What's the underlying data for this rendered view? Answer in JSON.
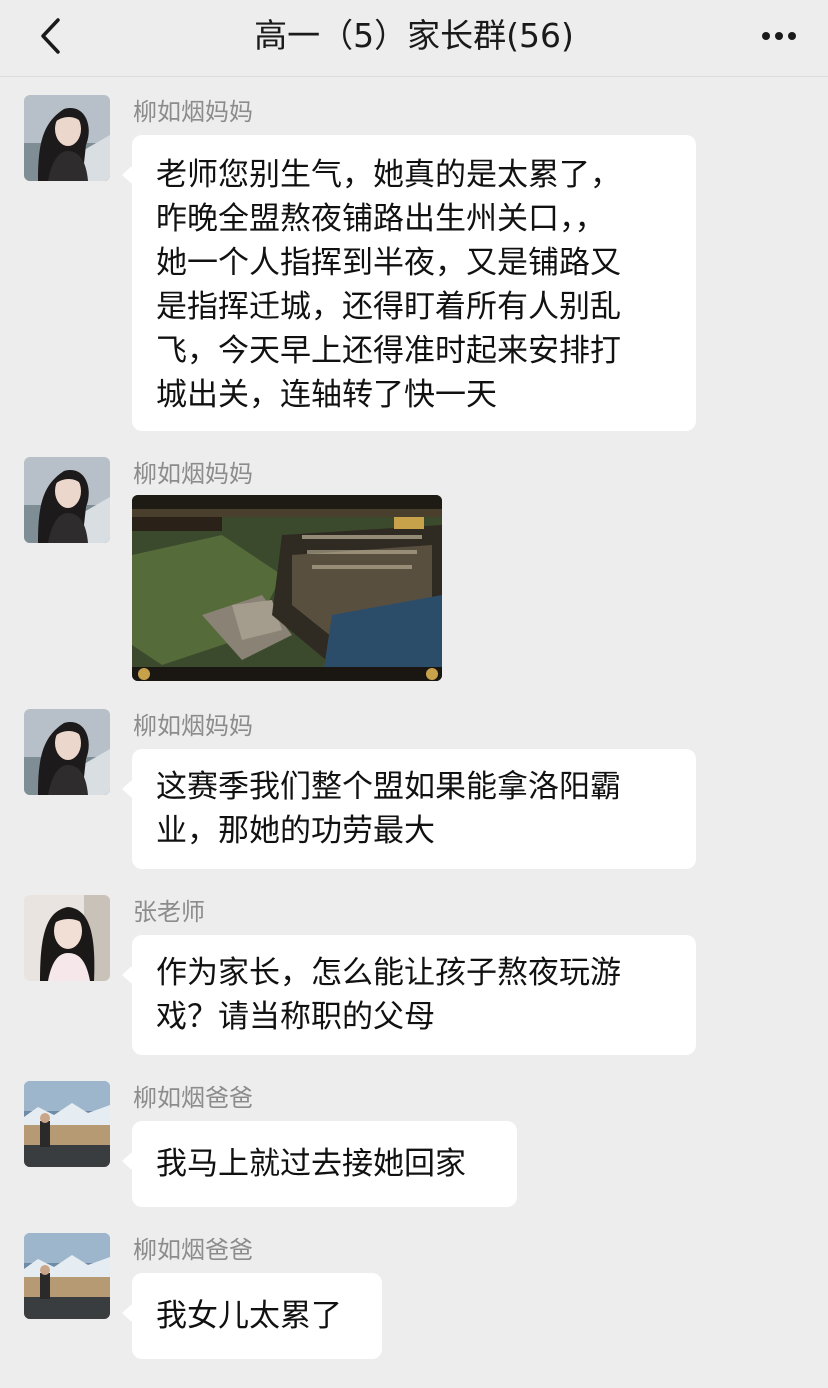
{
  "header": {
    "title": "高一（5）家长群(56)",
    "back_icon": "chevron-left-icon",
    "more_icon": "more-horizontal-icon"
  },
  "messages": [
    {
      "sender": "柳如烟妈妈",
      "type": "text",
      "lines": [
        "老师您别生气，她真的是太累了，",
        "昨晚全盟熬夜铺路出生州关口，，",
        "她一个人指挥到半夜，又是铺路又",
        "是指挥迁城，还得盯着所有人别乱",
        "飞，今天早上还得准时起来安排打",
        "城出关，连轴转了快一天"
      ]
    },
    {
      "sender": "柳如烟妈妈",
      "type": "image",
      "image": "strategy-game-screenshot"
    },
    {
      "sender": "柳如烟妈妈",
      "type": "text",
      "lines": [
        "这赛季我们整个盟如果能拿洛阳霸",
        "业，那她的功劳最大"
      ]
    },
    {
      "sender": "张老师",
      "type": "text",
      "lines": [
        "作为家长，怎么能让孩子熬夜玩游",
        "戏？请当称职的父母"
      ]
    },
    {
      "sender": "柳如烟爸爸",
      "type": "text",
      "lines": [
        "我马上就过去接她回家"
      ]
    },
    {
      "sender": "柳如烟爸爸",
      "type": "text",
      "lines": [
        "我女儿太累了"
      ]
    }
  ],
  "colors": {
    "background": "#ededed",
    "bubble": "#ffffff",
    "sender_name": "#8c8c8c",
    "text": "#111111"
  }
}
